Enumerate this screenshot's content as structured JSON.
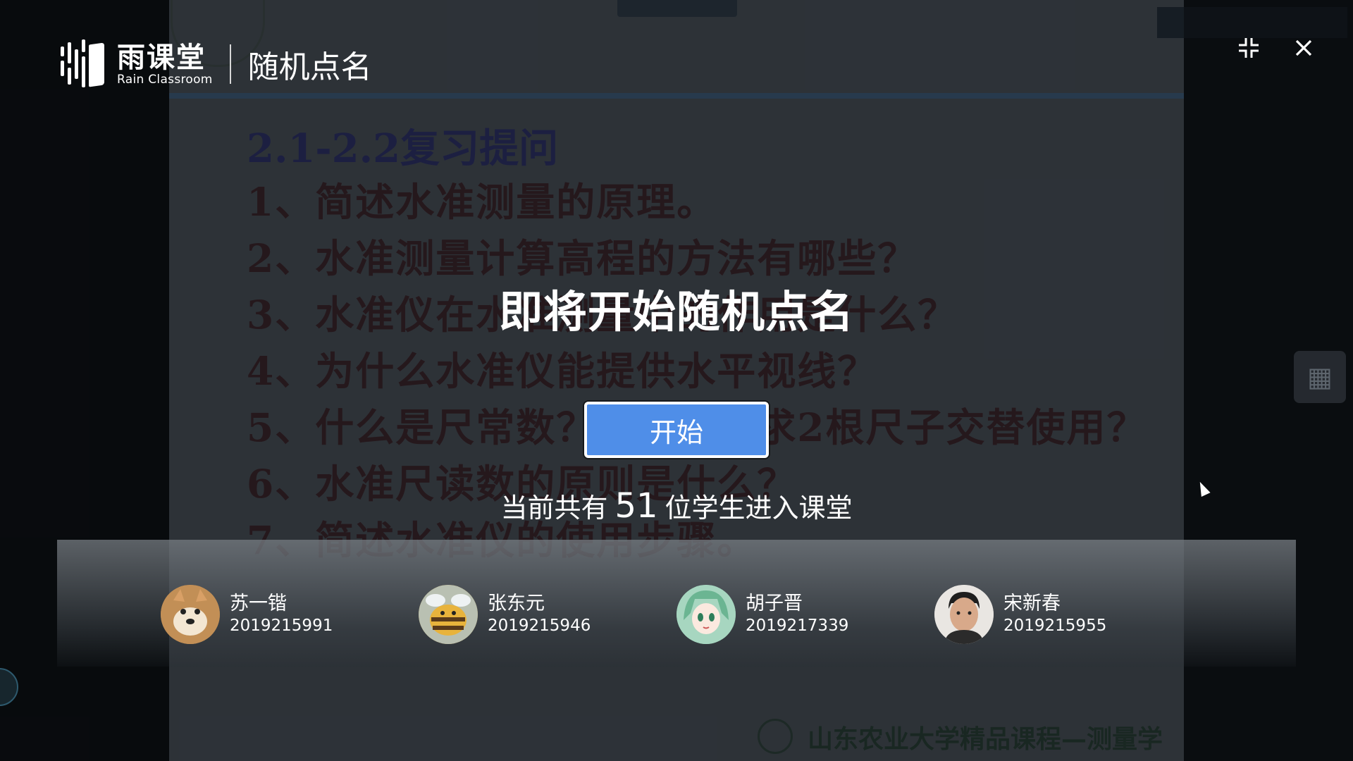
{
  "app": {
    "brand_cn": "雨课堂",
    "brand_en": "Rain Classroom",
    "title": "随机点名"
  },
  "window": {
    "exit_fullscreen_icon": "compress-icon",
    "close_icon": "close-icon"
  },
  "slide": {
    "title": "2.1-2.2复习提问",
    "questions": [
      "1、简述水准测量的原理。",
      "2、水准测量计算高程的方法有哪些？",
      "3、水准仪在水准测量中的作用是什么？",
      "4、为什么水准仪能提供水平视线？",
      "5、什么是尺常数？为什么要求2根尺子交替使用？",
      "6、水准尺读数的原则是什么？",
      "7、简述水准仪的使用步骤。"
    ],
    "footer": "山东农业大学精品课程—测量学"
  },
  "rollcall": {
    "headline": "即将开始随机点名",
    "start_label": "开始",
    "count_prefix": "当前共有",
    "count": "51",
    "count_suffix": "位学生进入课堂"
  },
  "students": [
    {
      "name": "苏一锴",
      "id": "2019215991",
      "avatar": "shiba-dog-avatar",
      "color": "#b98a55"
    },
    {
      "name": "张东元",
      "id": "2019215946",
      "avatar": "cartoon-bee-avatar",
      "color": "#c9a85a"
    },
    {
      "name": "胡子晋",
      "id": "2019217339",
      "avatar": "anime-girl-avatar",
      "color": "#8fc7b0"
    },
    {
      "name": "宋新春",
      "id": "2019215955",
      "avatar": "person-photo-avatar",
      "color": "#d7d2cc"
    }
  ],
  "colors": {
    "start_button": "#4f8ee8",
    "slide_title": "#2a2f68",
    "slide_text": "#3b2226"
  }
}
